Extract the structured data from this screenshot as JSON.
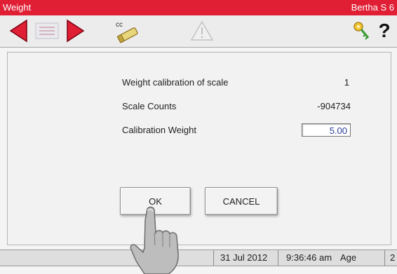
{
  "titlebar": {
    "title": "Weight",
    "device": "Bertha S 6"
  },
  "toolbar": {
    "icons": [
      "arrow-left-icon",
      "list-icon",
      "arrow-right-icon",
      "cc-icon",
      "warning-icon",
      "key-icon",
      "help-icon"
    ],
    "cc_label": "cc",
    "help_label": "?"
  },
  "form": {
    "scale_label": "Weight calibration of scale",
    "scale_value": "1",
    "counts_label": "Scale Counts",
    "counts_value": "-904734",
    "cal_weight_label": "Calibration Weight",
    "cal_weight_value": "5.00"
  },
  "buttons": {
    "ok": "OK",
    "cancel": "CANCEL"
  },
  "status": {
    "date": "31 Jul 2012",
    "time": "9:36:46 am",
    "age_label": "Age",
    "age_value": "2"
  },
  "colors": {
    "titlebar": "#e01f35",
    "accent_red": "#e01f35",
    "value_blue": "#2a3d9a"
  }
}
